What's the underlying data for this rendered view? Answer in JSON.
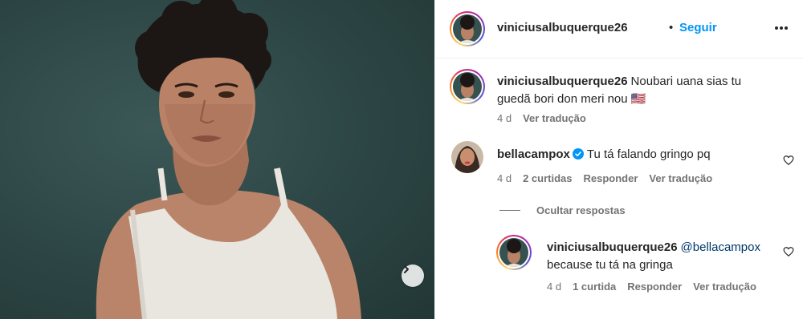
{
  "post": {
    "author": "viniciusalbuquerque26",
    "separator": "•",
    "follow_label": "Seguir",
    "more_icon": "more-horizontal-icon"
  },
  "caption": {
    "username": "viniciusalbuquerque26",
    "text": "Noubari uana sias tu guedã bori don meri nou 🇺🇸",
    "time": "4 d",
    "translate": "Ver tradução"
  },
  "comments": [
    {
      "username": "bellacampox",
      "verified": true,
      "text": "Tu tá falando gringo pq",
      "time": "4 d",
      "likes": "2 curtidas",
      "reply": "Responder",
      "translate": "Ver tradução"
    }
  ],
  "hide_replies_label": "Ocultar respostas",
  "replies": [
    {
      "username": "viniciusalbuquerque26",
      "mention": "@bellacampox",
      "text": "because tu tá na gringa",
      "time": "4 d",
      "likes": "1 curtida",
      "reply": "Responder",
      "translate": "Ver tradução"
    }
  ],
  "colors": {
    "accent": "#0095f6",
    "secondary_text": "#737373",
    "photo_background": "#2c4544"
  }
}
